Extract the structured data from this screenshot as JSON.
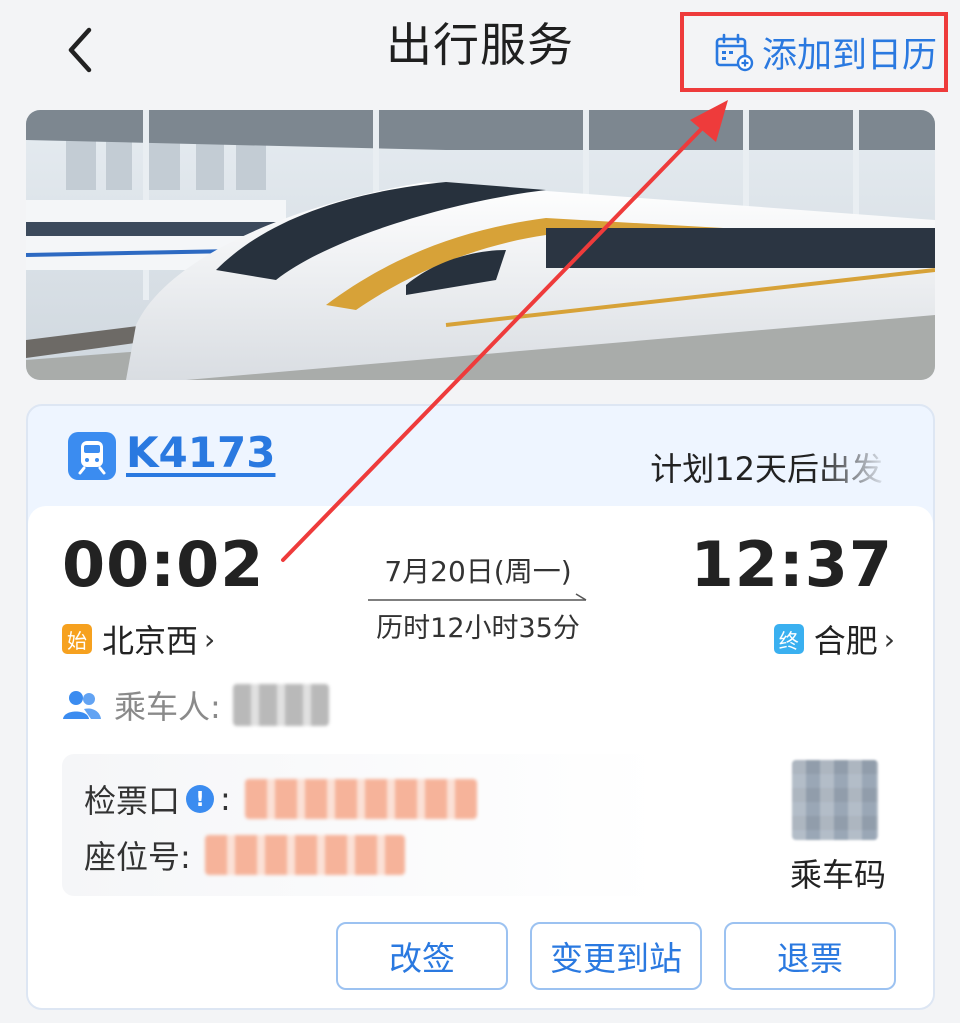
{
  "header": {
    "back_icon": "chevron-left-icon",
    "title": "出行服务",
    "add_calendar_label": "添加到日历",
    "calendar_icon": "calendar-add-icon"
  },
  "trip": {
    "train_number": "K4173",
    "train_icon": "train-icon",
    "plan_text": "计划12天后出发",
    "departure": {
      "time": "00:02",
      "station": "北京西",
      "tag": "始",
      "chevron": "›"
    },
    "arrival": {
      "time": "12:37",
      "station": "合肥",
      "tag": "终",
      "chevron": "›"
    },
    "date": "7月20日(周一)",
    "duration": "历时12小时35分",
    "passenger_label": "乘车人:",
    "gate_label": "检票口",
    "gate_colon": ":",
    "seat_label": "座位号:",
    "ride_code_label": "乘车码"
  },
  "actions": {
    "change_label": "改签",
    "change_station_label": "变更到站",
    "refund_label": "退票"
  },
  "colors": {
    "accent": "#2a79e0",
    "highlight_box": "#ee3b3b",
    "annotation_arrow": "#ee3b3b",
    "origin_tag": "#f6a11f",
    "destination_tag": "#3ab0f0"
  }
}
